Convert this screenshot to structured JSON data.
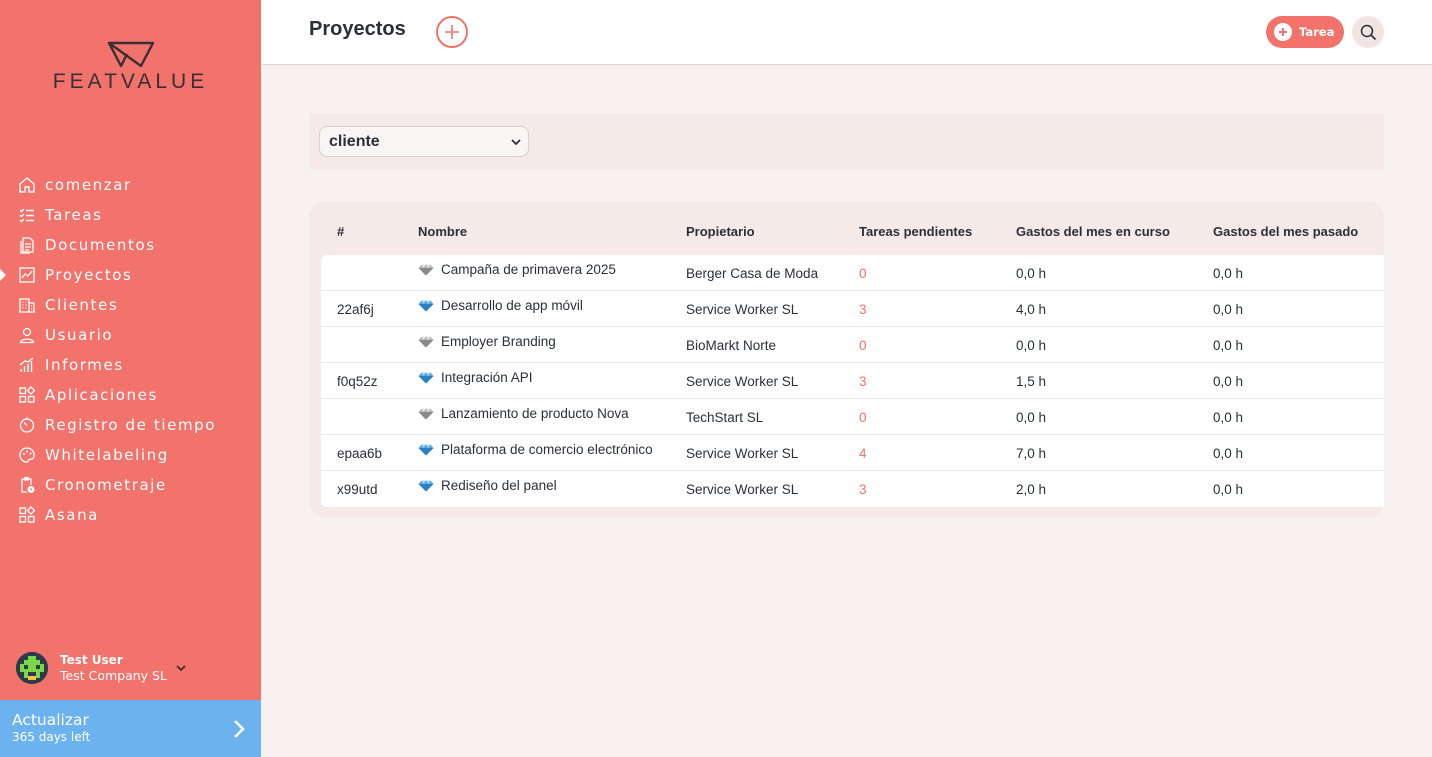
{
  "brand": {
    "name": "FEATVALUE"
  },
  "nav": {
    "items": [
      {
        "label": "comenzar",
        "icon": "home-icon"
      },
      {
        "label": "Tareas",
        "icon": "task-list-icon"
      },
      {
        "label": "Documentos",
        "icon": "documents-icon"
      },
      {
        "label": "Proyectos",
        "icon": "projects-icon",
        "active": true
      },
      {
        "label": "Clientes",
        "icon": "building-icon"
      },
      {
        "label": "Usuario",
        "icon": "user-icon"
      },
      {
        "label": "Informes",
        "icon": "reports-icon"
      },
      {
        "label": "Aplicaciones",
        "icon": "apps-icon"
      },
      {
        "label": "Registro de tiempo",
        "icon": "timer-icon"
      },
      {
        "label": "Whitelabeling",
        "icon": "palette-icon"
      },
      {
        "label": "Cronometraje",
        "icon": "clipboard-clock-icon"
      },
      {
        "label": "Asana",
        "icon": "apps-icon"
      }
    ]
  },
  "user": {
    "name": "Test User",
    "company": "Test Company SL"
  },
  "upgrade": {
    "title": "Actualizar",
    "subtitle": "365 days left"
  },
  "header": {
    "title": "Proyectos",
    "task_button": "Tarea"
  },
  "filter": {
    "selected": "cliente"
  },
  "table": {
    "columns": [
      "#",
      "Nombre",
      "Propietario",
      "Tareas pendientes",
      "Gastos del mes en curso",
      "Gastos del mes pasado"
    ],
    "rows": [
      {
        "id": "",
        "name": "Campaña de primavera 2025",
        "owner": "Berger Casa de Moda",
        "pending": "0",
        "current": "0,0 h",
        "last": "0,0 h",
        "gem": "silver"
      },
      {
        "id": "22af6j",
        "name": "Desarrollo de app móvil",
        "owner": "Service Worker SL",
        "pending": "3",
        "current": "4,0 h",
        "last": "0,0 h",
        "gem": "blue"
      },
      {
        "id": "",
        "name": "Employer Branding",
        "owner": "BioMarkt Norte",
        "pending": "0",
        "current": "0,0 h",
        "last": "0,0 h",
        "gem": "silver"
      },
      {
        "id": "f0q52z",
        "name": "Integración API",
        "owner": "Service Worker SL",
        "pending": "3",
        "current": "1,5 h",
        "last": "0,0 h",
        "gem": "blue"
      },
      {
        "id": "",
        "name": "Lanzamiento de producto Nova",
        "owner": "TechStart SL",
        "pending": "0",
        "current": "0,0 h",
        "last": "0,0 h",
        "gem": "silver"
      },
      {
        "id": "epaa6b",
        "name": "Plataforma de comercio electrónico",
        "owner": "Service Worker SL",
        "pending": "4",
        "current": "7,0 h",
        "last": "0,0 h",
        "gem": "blue"
      },
      {
        "id": "x99utd",
        "name": "Rediseño del panel",
        "owner": "Service Worker SL",
        "pending": "3",
        "current": "2,0 h",
        "last": "0,0 h",
        "gem": "blue"
      }
    ]
  },
  "colors": {
    "accent": "#f2736b",
    "upgrade": "#6cb2ee",
    "background": "#f7f2f1"
  }
}
